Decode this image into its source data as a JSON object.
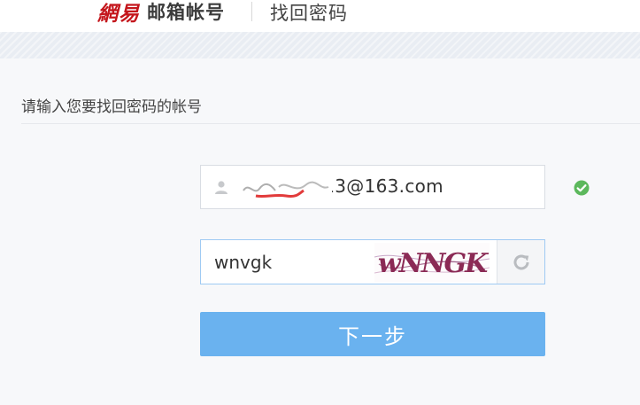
{
  "header": {
    "brand_netease": "網易",
    "brand_product": "邮箱帐号",
    "page_title": "找回密码"
  },
  "form": {
    "section_title": "请输入您要找回密码的帐号",
    "account": {
      "icon": "user-icon",
      "value": "········ng613@163.com",
      "status_icon": "check-circle-icon",
      "status_color": "#5cb85c"
    },
    "captcha": {
      "value": "wnvgk",
      "image_text": "wNNGK",
      "refresh_icon": "refresh-icon"
    },
    "next_button_label": "下一步",
    "accent_color": "#6ab2ef"
  }
}
